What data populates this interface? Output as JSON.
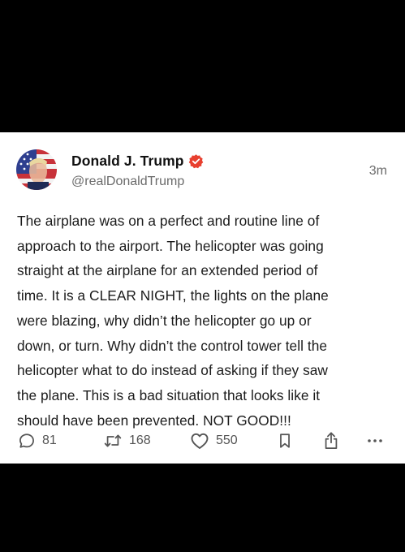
{
  "post": {
    "author_name": "Donald J. Trump",
    "author_handle": "@realDonaldTrump",
    "timestamp": "3m",
    "verified": true,
    "text": "The airplane was on a perfect and routine line of\napproach to the airport. The helicopter was going\nstraight at the airplane for an extended period of\ntime. It is a CLEAR NIGHT, the lights on the plane\nwere blazing, why didn’t the helicopter go up or\ndown, or turn. Why didn’t the control tower tell the\nhelicopter what to do instead of asking if they saw\nthe plane. This is a bad situation that looks like it\nshould have been prevented. NOT GOOD!!!"
  },
  "actions": {
    "reply_count": "81",
    "retruth_count": "168",
    "like_count": "550",
    "icons": [
      "reply-icon",
      "retruth-icon",
      "like-icon",
      "bookmark-icon",
      "share-icon",
      "more-icon"
    ]
  },
  "colors": {
    "background": "#000000",
    "card": "#ffffff",
    "text": "#1b1b1b",
    "muted": "#6b6b6b",
    "verified_badge": "#e8402f"
  }
}
